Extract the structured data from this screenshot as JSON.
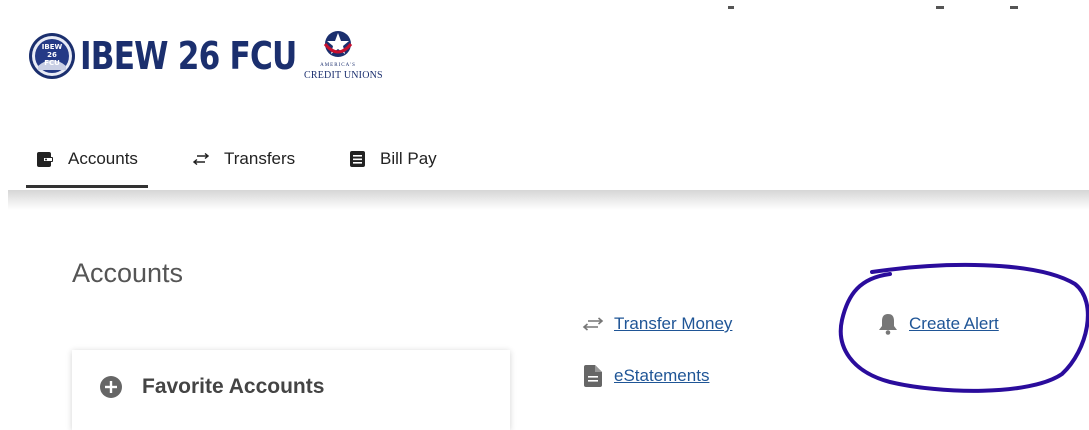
{
  "header": {
    "logo_text": "IBEW 26 FCU",
    "seal_text": [
      "IBEW",
      "26",
      "FCU"
    ],
    "partner_logo_small": "AMERICA'S",
    "partner_logo_text": "CREDIT UNIONS"
  },
  "nav": {
    "tabs": [
      {
        "label": "Accounts",
        "icon": "wallet-icon",
        "active": true
      },
      {
        "label": "Transfers",
        "icon": "transfer-arrows-icon",
        "active": false
      },
      {
        "label": "Bill Pay",
        "icon": "bill-icon",
        "active": false
      }
    ]
  },
  "main": {
    "title": "Accounts",
    "quick_links": [
      {
        "label": "Transfer Money",
        "icon": "transfer-arrows-icon"
      },
      {
        "label": "eStatements",
        "icon": "document-icon"
      },
      {
        "label": "Create Alert",
        "icon": "bell-icon"
      }
    ],
    "favorites": {
      "title": "Favorite Accounts",
      "icon": "plus-circle-icon"
    }
  },
  "colors": {
    "brand_navy": "#1b2f6e",
    "link_blue": "#1f5596",
    "annotation_purple": "#2a0c9c",
    "text_dark": "#222222"
  }
}
